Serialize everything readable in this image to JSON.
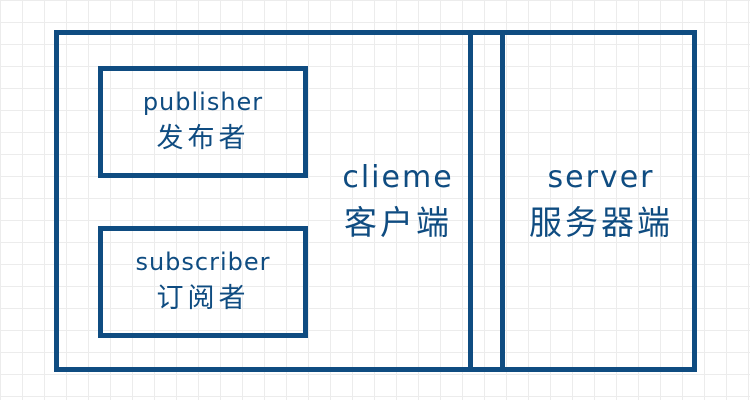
{
  "colors": {
    "stroke": "#0f4c81",
    "text": "#0f4c81",
    "background": "#ffffff",
    "grid": "#ececec"
  },
  "publisher": {
    "label_en": "publisher",
    "label_zh": "发布者"
  },
  "subscriber": {
    "label_en": "subscriber",
    "label_zh": "订阅者"
  },
  "client": {
    "label_en": "clieme",
    "label_zh": "客户端"
  },
  "server": {
    "label_en": "server",
    "label_zh": "服务器端"
  }
}
